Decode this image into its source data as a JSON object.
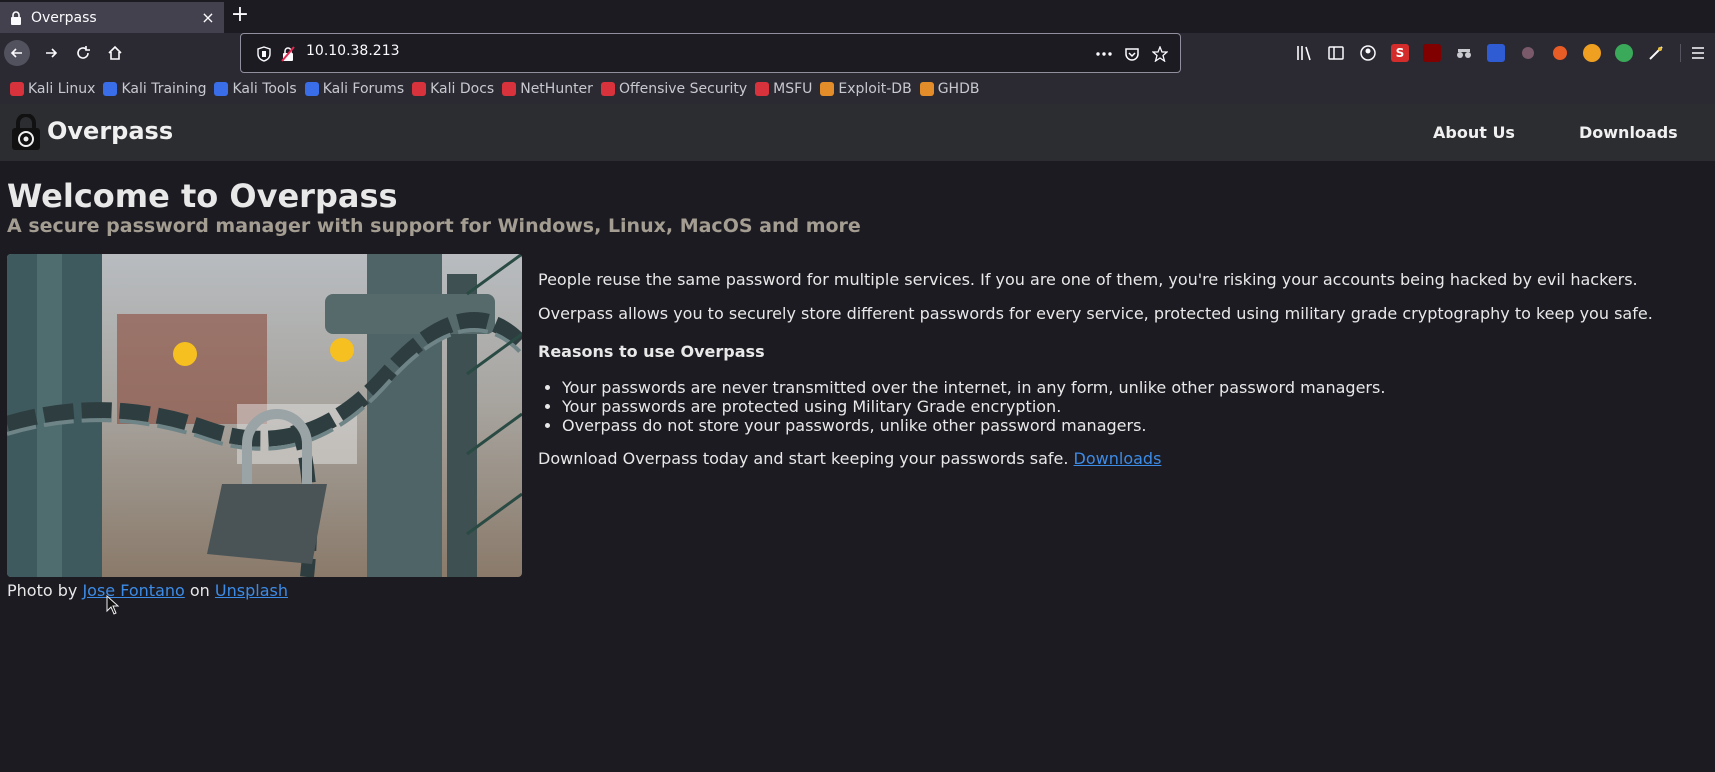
{
  "browser": {
    "tab": {
      "title": "Overpass",
      "close_glyph": "×"
    },
    "new_tab_glyph": "+",
    "url": "10.10.38.213",
    "bookmarks": [
      {
        "label": "Kali Linux",
        "color": "#d8333c"
      },
      {
        "label": "Kali Training",
        "color": "#3a6ee8"
      },
      {
        "label": "Kali Tools",
        "color": "#3a6ee8"
      },
      {
        "label": "Kali Forums",
        "color": "#3a6ee8"
      },
      {
        "label": "Kali Docs",
        "color": "#d8333c"
      },
      {
        "label": "NetHunter",
        "color": "#d8333c"
      },
      {
        "label": "Offensive Security",
        "color": "#d8333c"
      },
      {
        "label": "MSFU",
        "color": "#d8333c"
      },
      {
        "label": "Exploit-DB",
        "color": "#e28d2a"
      },
      {
        "label": "GHDB",
        "color": "#e28d2a"
      }
    ]
  },
  "site": {
    "brand": "Overpass",
    "nav": {
      "about": "About Us",
      "downloads": "Downloads"
    },
    "heading": "Welcome to Overpass",
    "subheading": "A secure password manager with support for Windows, Linux, MacOS and more",
    "credit": {
      "prefix": "Photo by",
      "author": "Jose Fontano",
      "middle": "on",
      "source": "Unsplash"
    },
    "intro1": "People reuse the same password for multiple services. If you are one of them, you're risking your accounts being hacked by evil hackers.",
    "intro2": "Overpass allows you to securely store different passwords for every service, protected using military grade cryptography to keep you safe.",
    "reasons_title": "Reasons to use Overpass",
    "reasons": [
      "Your passwords are never transmitted over the internet, in any form, unlike other password managers.",
      "Your passwords are protected using Military Grade encryption.",
      "Overpass do not store your passwords, unlike other password managers."
    ],
    "cta_text": "Download Overpass today and start keeping your passwords safe.",
    "cta_link": "Downloads"
  },
  "colors": {
    "accent_link": "#3c8ce7",
    "subheading": "#a49d91",
    "header_bg": "#2c2d31",
    "page_bg": "#1c1b22"
  }
}
